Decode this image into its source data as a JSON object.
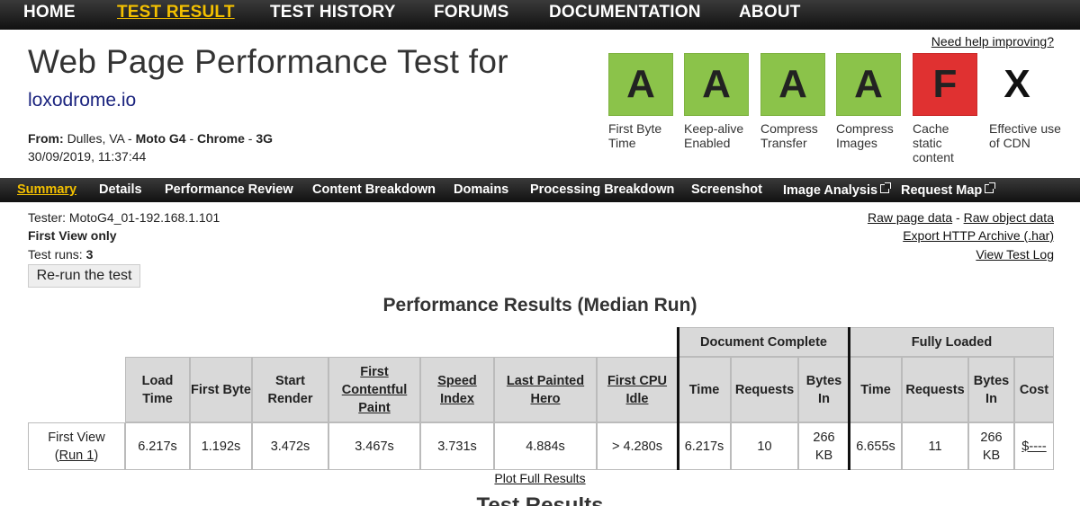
{
  "topnav": {
    "items": [
      {
        "label": "HOME",
        "active": false
      },
      {
        "label": "TEST RESULT",
        "active": true
      },
      {
        "label": "TEST HISTORY",
        "active": false
      },
      {
        "label": "FORUMS",
        "active": false
      },
      {
        "label": "DOCUMENTATION",
        "active": false
      },
      {
        "label": "ABOUT",
        "active": false
      }
    ]
  },
  "help_link": "Need help improving?",
  "header": {
    "title": "Web Page Performance Test for",
    "url": "loxodrome.io",
    "from_label": "From:",
    "location": "Dulles, VA",
    "device": "Moto G4",
    "browser": "Chrome",
    "connection": "3G",
    "sep": " - ",
    "datetime": "30/09/2019, 11:37:44"
  },
  "grades": [
    {
      "grade": "A",
      "label": "First Byte Time",
      "color": "#8bc34a"
    },
    {
      "grade": "A",
      "label": "Keep-alive Enabled",
      "color": "#8bc34a"
    },
    {
      "grade": "A",
      "label": "Compress Transfer",
      "color": "#8bc34a"
    },
    {
      "grade": "A",
      "label": "Compress Images",
      "color": "#8bc34a"
    },
    {
      "grade": "F",
      "label": "Cache static content",
      "color": "#e03131"
    },
    {
      "grade": "X",
      "label": "Effective use of CDN",
      "color": "none"
    }
  ],
  "subnav": {
    "items": [
      {
        "label": "Summary",
        "active": true
      },
      {
        "label": "Details"
      },
      {
        "label": "Performance Review"
      },
      {
        "label": "Content Breakdown"
      },
      {
        "label": "Domains"
      },
      {
        "label": "Processing Breakdown"
      },
      {
        "label": "Screenshot"
      },
      {
        "label": "Image Analysis",
        "icon": "external-link-icon"
      },
      {
        "label": "Request Map",
        "icon": "external-link-icon"
      }
    ]
  },
  "test_info": {
    "tester": "Tester: MotoG4_01-192.168.1.101",
    "view": "First View only",
    "runs_label": "Test runs: ",
    "runs_value": "3",
    "rerun_button": "Re-run the test"
  },
  "raw_links": {
    "raw_page": "Raw page data",
    "sep": " - ",
    "raw_object": "Raw object data",
    "export_har": "Export HTTP Archive (.har)",
    "view_log": "View Test Log"
  },
  "results": {
    "title": "Performance Results (Median Run)",
    "group_document": "Document Complete",
    "group_fully": "Fully Loaded",
    "columns": {
      "load_time": "Load Time",
      "first_byte": "First Byte",
      "start_render": "Start Render",
      "fcp": "First Contentful Paint",
      "speed_index": "Speed Index",
      "lph": "Last Painted Hero",
      "cpu_idle": "First CPU Idle",
      "doc_time": "Time",
      "doc_requests": "Requests",
      "doc_bytes": "Bytes In",
      "fl_time": "Time",
      "fl_requests": "Requests",
      "fl_bytes": "Bytes In",
      "cost": "Cost"
    },
    "row": {
      "label": "First View",
      "run_prefix": "(",
      "run_link": "Run 1",
      "run_suffix": ")",
      "load_time": "6.217s",
      "first_byte": "1.192s",
      "start_render": "3.472s",
      "fcp": "3.467s",
      "speed_index": "3.731s",
      "lph": "4.884s",
      "cpu_idle": "> 4.280s",
      "doc_time": "6.217s",
      "doc_requests": "10",
      "doc_bytes": "266 KB",
      "fl_time": "6.655s",
      "fl_requests": "11",
      "fl_bytes": "266 KB",
      "cost": "$----"
    },
    "plot_link": "Plot Full Results",
    "next_title": "Test Results"
  }
}
